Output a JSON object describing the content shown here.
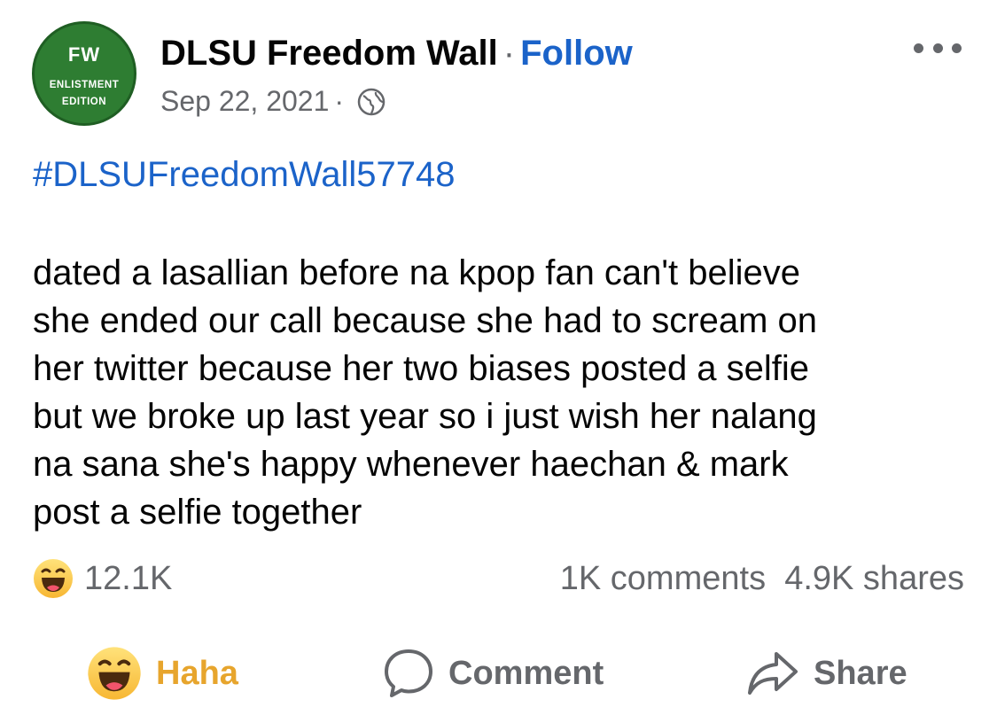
{
  "avatar": {
    "line1": "FW",
    "line2": "ENLISTMENT",
    "line3": "EDITION"
  },
  "header": {
    "page_name": "DLSU Freedom Wall",
    "separator": "·",
    "follow_label": "Follow",
    "date": "Sep 22, 2021",
    "date_separator": "·",
    "audience_icon": "globe-icon",
    "more_icon": "more-options-icon"
  },
  "post": {
    "hashtag": "#DLSUFreedomWall57748",
    "lines": [
      "dated a lasallian before na kpop fan can't believe",
      "she ended our call because she had to scream on",
      "her twitter because her two biases posted a selfie",
      "but we broke up last year so i just wish her nalang",
      "na sana she's happy whenever haechan & mark",
      "post a selfie together"
    ]
  },
  "stats": {
    "reaction_icon": "haha-emoji-icon",
    "reaction_count": "12.1K",
    "comments": "1K comments",
    "shares": "4.9K shares"
  },
  "actions": {
    "haha_label": "Haha",
    "comment_label": "Comment",
    "share_label": "Share"
  },
  "colors": {
    "link_blue": "#1b63c9",
    "secondary_gray": "#65676b",
    "haha_yellow": "#e7a52d",
    "avatar_green": "#2e7d32"
  }
}
